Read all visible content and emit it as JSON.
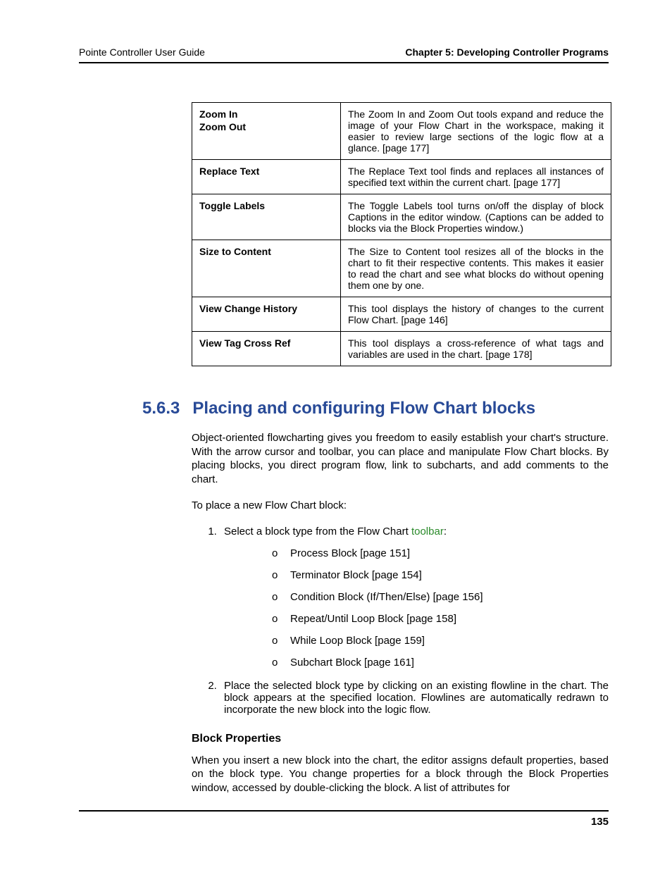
{
  "header": {
    "left": "Pointe Controller User Guide",
    "right": "Chapter 5: Developing Controller Programs"
  },
  "table_rows": [
    {
      "label1": "Zoom In",
      "label2": "Zoom Out",
      "desc": "The Zoom In and Zoom Out tools expand and reduce the image of your Flow Chart in the workspace, making it easier to review large sections of the logic flow at a glance. [page 177]"
    },
    {
      "label1": "Replace Text",
      "desc": "The Replace Text tool finds and replaces all instances of specified text within the current chart. [page 177]"
    },
    {
      "label1": "Toggle Labels",
      "desc": "The Toggle Labels tool turns on/off the display of block Captions in the editor window. (Captions can be added to blocks via the Block Properties window.)"
    },
    {
      "label1": "Size to Content",
      "desc": "The Size to Content tool resizes all of the blocks in the chart to fit their respective contents. This makes it easier to read the chart and see what blocks do without opening them one by one."
    },
    {
      "label1": "View Change History",
      "desc": "This tool displays the history of changes to the current Flow Chart. [page 146]"
    },
    {
      "label1": "View Tag Cross Ref",
      "desc": "This tool displays a cross-reference of what tags and variables are used in the chart. [page 178]"
    }
  ],
  "section": {
    "number": "5.6.3",
    "title": "Placing and configuring Flow Chart blocks"
  },
  "para_intro": "Object-oriented flowcharting gives you freedom to easily establish your chart's structure. With the arrow cursor and toolbar, you can place and manipulate Flow Chart blocks. By placing blocks, you direct program flow, link to subcharts, and add comments to the chart.",
  "para_lead": "To place a new Flow Chart block:",
  "step1_pre": "Select a block type from the Flow Chart ",
  "step1_link": "toolbar",
  "step1_post": ":",
  "block_list": [
    "Process Block [page 151]",
    "Terminator Block [page 154]",
    "Condition Block (If/Then/Else) [page 156]",
    "Repeat/Until Loop Block [page 158]",
    "While Loop Block [page 159]",
    "Subchart Block [page 161]"
  ],
  "step2": "Place the selected block type by clicking on an existing flowline in the chart. The block appears at the specified location. Flowlines are automatically redrawn to incorporate the new block into the logic flow.",
  "subheading": "Block Properties",
  "para_props": "When you insert a new block into the chart, the editor assigns default properties, based on the block type. You change properties for a block through the Block Properties window, accessed by double-clicking the block. A list of attributes for",
  "page_number": "135"
}
